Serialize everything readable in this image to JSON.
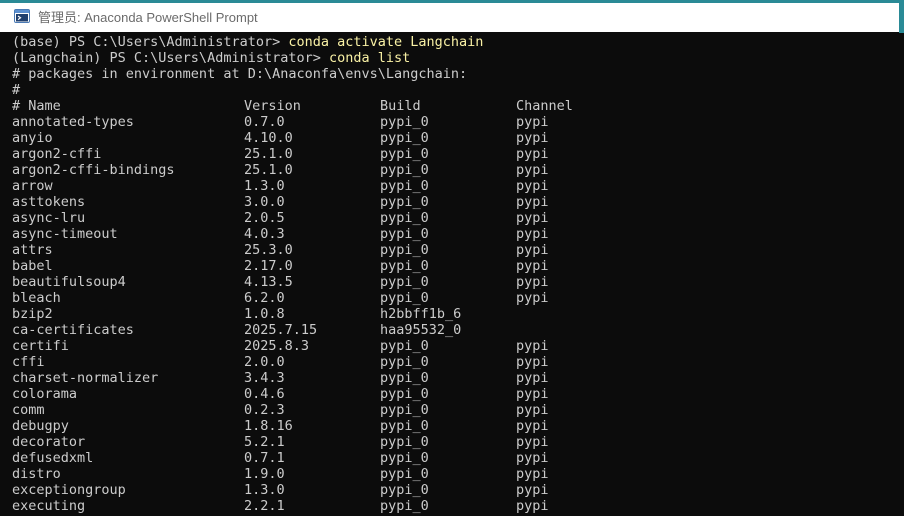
{
  "window": {
    "title": "管理员: Anaconda PowerShell Prompt"
  },
  "prompt_lines": [
    {
      "prompt": "(base) PS C:\\Users\\Administrator> ",
      "command": "conda activate Langchain"
    },
    {
      "prompt": "(Langchain) PS C:\\Users\\Administrator> ",
      "command": "conda list"
    }
  ],
  "comment_lines": [
    "# packages in environment at D:\\Anaconfa\\envs\\Langchain:",
    "#"
  ],
  "table": {
    "headers": {
      "name": "# Name",
      "version": "Version",
      "build": "Build",
      "channel": "Channel"
    },
    "rows": [
      {
        "name": "annotated-types",
        "version": "0.7.0",
        "build": "pypi_0",
        "channel": "pypi"
      },
      {
        "name": "anyio",
        "version": "4.10.0",
        "build": "pypi_0",
        "channel": "pypi"
      },
      {
        "name": "argon2-cffi",
        "version": "25.1.0",
        "build": "pypi_0",
        "channel": "pypi"
      },
      {
        "name": "argon2-cffi-bindings",
        "version": "25.1.0",
        "build": "pypi_0",
        "channel": "pypi"
      },
      {
        "name": "arrow",
        "version": "1.3.0",
        "build": "pypi_0",
        "channel": "pypi"
      },
      {
        "name": "asttokens",
        "version": "3.0.0",
        "build": "pypi_0",
        "channel": "pypi"
      },
      {
        "name": "async-lru",
        "version": "2.0.5",
        "build": "pypi_0",
        "channel": "pypi"
      },
      {
        "name": "async-timeout",
        "version": "4.0.3",
        "build": "pypi_0",
        "channel": "pypi"
      },
      {
        "name": "attrs",
        "version": "25.3.0",
        "build": "pypi_0",
        "channel": "pypi"
      },
      {
        "name": "babel",
        "version": "2.17.0",
        "build": "pypi_0",
        "channel": "pypi"
      },
      {
        "name": "beautifulsoup4",
        "version": "4.13.5",
        "build": "pypi_0",
        "channel": "pypi"
      },
      {
        "name": "bleach",
        "version": "6.2.0",
        "build": "pypi_0",
        "channel": "pypi"
      },
      {
        "name": "bzip2",
        "version": "1.0.8",
        "build": "h2bbff1b_6",
        "channel": ""
      },
      {
        "name": "ca-certificates",
        "version": "2025.7.15",
        "build": "haa95532_0",
        "channel": ""
      },
      {
        "name": "certifi",
        "version": "2025.8.3",
        "build": "pypi_0",
        "channel": "pypi"
      },
      {
        "name": "cffi",
        "version": "2.0.0",
        "build": "pypi_0",
        "channel": "pypi"
      },
      {
        "name": "charset-normalizer",
        "version": "3.4.3",
        "build": "pypi_0",
        "channel": "pypi"
      },
      {
        "name": "colorama",
        "version": "0.4.6",
        "build": "pypi_0",
        "channel": "pypi"
      },
      {
        "name": "comm",
        "version": "0.2.3",
        "build": "pypi_0",
        "channel": "pypi"
      },
      {
        "name": "debugpy",
        "version": "1.8.16",
        "build": "pypi_0",
        "channel": "pypi"
      },
      {
        "name": "decorator",
        "version": "5.2.1",
        "build": "pypi_0",
        "channel": "pypi"
      },
      {
        "name": "defusedxml",
        "version": "0.7.1",
        "build": "pypi_0",
        "channel": "pypi"
      },
      {
        "name": "distro",
        "version": "1.9.0",
        "build": "pypi_0",
        "channel": "pypi"
      },
      {
        "name": "exceptiongroup",
        "version": "1.3.0",
        "build": "pypi_0",
        "channel": "pypi"
      },
      {
        "name": "executing",
        "version": "2.2.1",
        "build": "pypi_0",
        "channel": "pypi"
      }
    ]
  },
  "icons": {
    "app": "powershell-app-icon"
  },
  "colors": {
    "background": "#0c0c0c",
    "text": "#cccccc",
    "command": "#f9f1a5",
    "titlebar": "#ffffff",
    "accent": "#2a8a96"
  }
}
